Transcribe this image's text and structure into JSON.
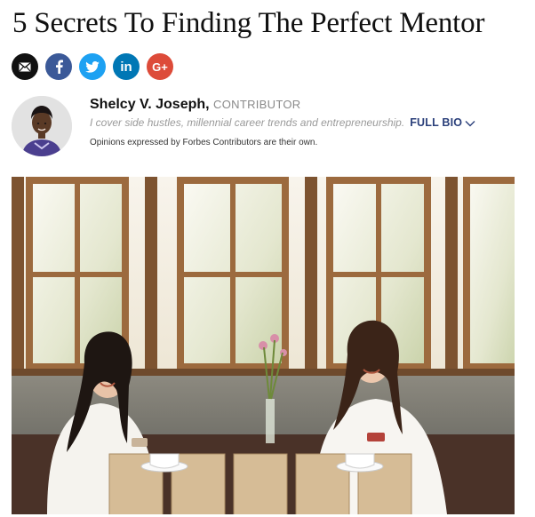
{
  "article": {
    "title": "5 Secrets To Finding The Perfect Mentor"
  },
  "share": {
    "buttons": [
      {
        "name": "email",
        "icon": "envelope-icon",
        "color": "#111111"
      },
      {
        "name": "facebook",
        "icon": "facebook-icon",
        "color": "#3b5998"
      },
      {
        "name": "twitter",
        "icon": "twitter-bird-icon",
        "color": "#1da1f2"
      },
      {
        "name": "linkedin",
        "icon": "linkedin-icon",
        "color": "#0077b5",
        "glyph": "in"
      },
      {
        "name": "googleplus",
        "icon": "google-plus-icon",
        "color": "#dd4b39",
        "glyph": "G+"
      }
    ]
  },
  "author": {
    "name": "Shelcy V. Joseph",
    "separator": ",",
    "role": "CONTRIBUTOR",
    "bio": "I cover side hustles, millennial career trends and entrepreneurship.",
    "full_bio_label": "FULL BIO",
    "disclaimer": "Opinions expressed by Forbes Contributors are their own."
  },
  "colors": {
    "link_blue": "#2a3f7a",
    "role_gray": "#8a8a8a"
  }
}
